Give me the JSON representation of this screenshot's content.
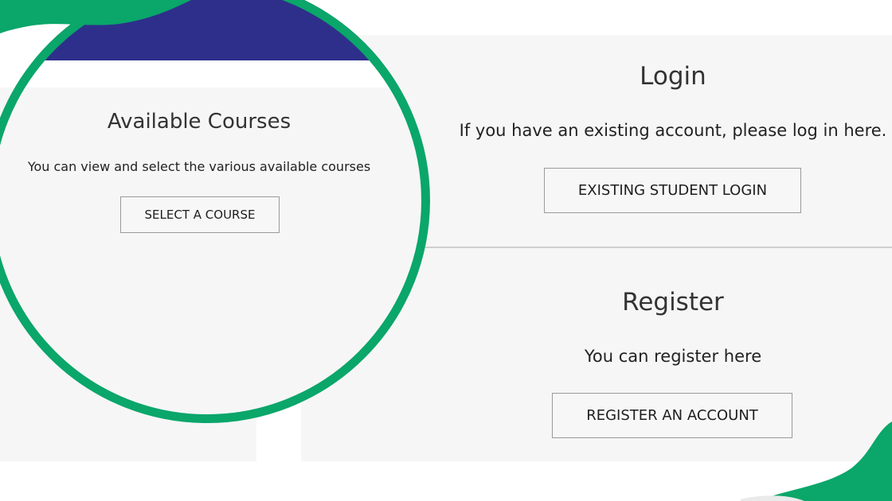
{
  "courses": {
    "title": "Available Courses",
    "description": "You can view and select the various available courses",
    "button_label": "SELECT A COURSE"
  },
  "login": {
    "title": "Login",
    "description": "If you have an existing account, please log in here.",
    "button_label": "EXISTING STUDENT LOGIN"
  },
  "register": {
    "title": "Register",
    "description": "You can register here",
    "button_label": "REGISTER AN ACCOUNT"
  },
  "colors": {
    "header": "#2e2f8b",
    "accent_green": "#0aa66a",
    "panel_bg": "#f6f6f6"
  }
}
